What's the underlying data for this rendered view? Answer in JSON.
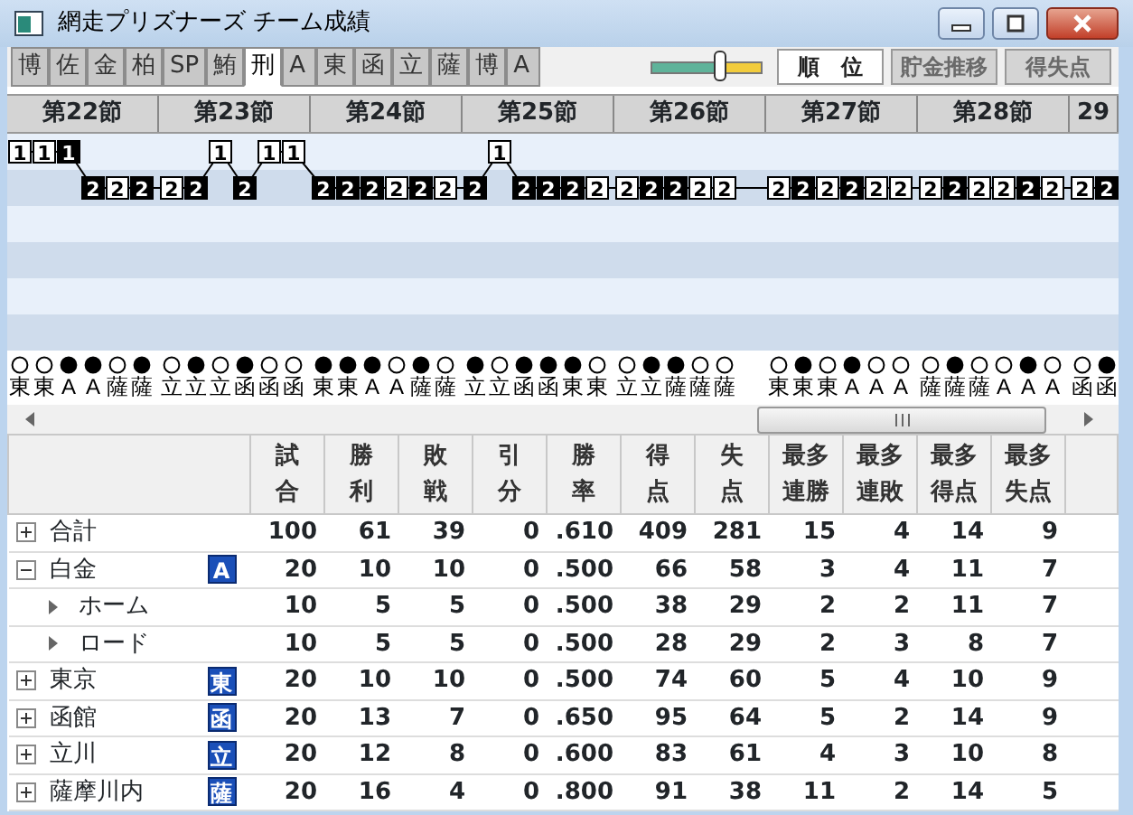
{
  "window": {
    "title": "網走プリズナーズ チーム成績"
  },
  "team_tabs": [
    {
      "label": "博",
      "selected": false
    },
    {
      "label": "佐",
      "selected": false
    },
    {
      "label": "金",
      "selected": false
    },
    {
      "label": "柏",
      "selected": false
    },
    {
      "label": "SP",
      "selected": false
    },
    {
      "label": "鮪",
      "selected": false
    },
    {
      "label": "刑",
      "selected": true
    },
    {
      "label": "A",
      "selected": false
    },
    {
      "label": "東",
      "selected": false
    },
    {
      "label": "函",
      "selected": false
    },
    {
      "label": "立",
      "selected": false
    },
    {
      "label": "薩",
      "selected": false
    },
    {
      "label": "博",
      "selected": false
    },
    {
      "label": "A",
      "selected": false
    }
  ],
  "zoom_slider": {
    "level": 0.62
  },
  "view_buttons": [
    {
      "label": "順　位",
      "selected": true,
      "disabled": false
    },
    {
      "label": "貯金推移",
      "selected": false,
      "disabled": true
    },
    {
      "label": "得失点",
      "selected": false,
      "disabled": true
    }
  ],
  "sections": [
    {
      "label": "第22節",
      "games": [
        {
          "rank": "1",
          "win": false,
          "opponent": "東"
        },
        {
          "rank": "1",
          "win": false,
          "opponent": "東"
        },
        {
          "rank": "1",
          "win": true,
          "opponent": "A"
        },
        {
          "rank": "2",
          "win": true,
          "opponent": "A"
        },
        {
          "rank": "2",
          "win": false,
          "opponent": "薩"
        },
        {
          "rank": "2",
          "win": true,
          "opponent": "薩"
        }
      ]
    },
    {
      "label": "第23節",
      "games": [
        {
          "rank": "2",
          "win": false,
          "opponent": "立"
        },
        {
          "rank": "2",
          "win": true,
          "opponent": "立"
        },
        {
          "rank": "1",
          "win": false,
          "opponent": "立"
        },
        {
          "rank": "2",
          "win": true,
          "opponent": "函"
        },
        {
          "rank": "1",
          "win": false,
          "opponent": "函"
        },
        {
          "rank": "1",
          "win": false,
          "opponent": "函"
        }
      ]
    },
    {
      "label": "第24節",
      "games": [
        {
          "rank": "2",
          "win": true,
          "opponent": "東"
        },
        {
          "rank": "2",
          "win": true,
          "opponent": "東"
        },
        {
          "rank": "2",
          "win": true,
          "opponent": "A"
        },
        {
          "rank": "2",
          "win": false,
          "opponent": "A"
        },
        {
          "rank": "2",
          "win": true,
          "opponent": "薩"
        },
        {
          "rank": "2",
          "win": false,
          "opponent": "薩"
        }
      ]
    },
    {
      "label": "第25節",
      "games": [
        {
          "rank": "2",
          "win": true,
          "opponent": "立"
        },
        {
          "rank": "1",
          "win": false,
          "opponent": "立"
        },
        {
          "rank": "2",
          "win": true,
          "opponent": "函"
        },
        {
          "rank": "2",
          "win": true,
          "opponent": "函"
        },
        {
          "rank": "2",
          "win": true,
          "opponent": "東"
        },
        {
          "rank": "2",
          "win": false,
          "opponent": "東"
        }
      ]
    },
    {
      "label": "第26節",
      "games": [
        {
          "rank": "2",
          "win": false,
          "opponent": "立"
        },
        {
          "rank": "2",
          "win": true,
          "opponent": "立"
        },
        {
          "rank": "2",
          "win": true,
          "opponent": "薩"
        },
        {
          "rank": "2",
          "win": false,
          "opponent": "薩"
        },
        {
          "rank": "2",
          "win": false,
          "opponent": "薩"
        }
      ]
    },
    {
      "label": "第27節",
      "games": [
        {
          "rank": "2",
          "win": false,
          "opponent": "東"
        },
        {
          "rank": "2",
          "win": true,
          "opponent": "東"
        },
        {
          "rank": "2",
          "win": false,
          "opponent": "東"
        },
        {
          "rank": "2",
          "win": true,
          "opponent": "A"
        },
        {
          "rank": "2",
          "win": false,
          "opponent": "A"
        },
        {
          "rank": "2",
          "win": false,
          "opponent": "A"
        }
      ]
    },
    {
      "label": "第28節",
      "games": [
        {
          "rank": "2",
          "win": false,
          "opponent": "薩"
        },
        {
          "rank": "2",
          "win": true,
          "opponent": "薩"
        },
        {
          "rank": "2",
          "win": false,
          "opponent": "薩"
        },
        {
          "rank": "2",
          "win": false,
          "opponent": "A"
        },
        {
          "rank": "2",
          "win": true,
          "opponent": "A"
        },
        {
          "rank": "2",
          "win": false,
          "opponent": "A"
        }
      ]
    },
    {
      "label": "29",
      "games": [
        {
          "rank": "2",
          "win": false,
          "opponent": "函"
        },
        {
          "rank": "2",
          "win": true,
          "opponent": "函"
        }
      ]
    }
  ],
  "table": {
    "columns": [
      "試合",
      "勝利",
      "敗戦",
      "引分",
      "勝率",
      "得点",
      "失点",
      "最多連勝",
      "最多連敗",
      "最多得点",
      "最多失点"
    ],
    "rows": [
      {
        "name": "合計",
        "expanded": false,
        "values": [
          "100",
          "61",
          "39",
          "0",
          ".610",
          "409",
          "281",
          "15",
          "4",
          "14",
          "9"
        ]
      },
      {
        "name": "白金",
        "expanded": true,
        "badge": "A",
        "values": [
          "20",
          "10",
          "10",
          "0",
          ".500",
          "66",
          "58",
          "3",
          "4",
          "11",
          "7"
        ],
        "children": [
          {
            "name": "ホーム",
            "values": [
              "10",
              "5",
              "5",
              "0",
              ".500",
              "38",
              "29",
              "2",
              "2",
              "11",
              "7"
            ]
          },
          {
            "name": "ロード",
            "values": [
              "10",
              "5",
              "5",
              "0",
              ".500",
              "28",
              "29",
              "2",
              "3",
              "8",
              "7"
            ]
          }
        ]
      },
      {
        "name": "東京",
        "expanded": false,
        "badge": "東",
        "values": [
          "20",
          "10",
          "10",
          "0",
          ".500",
          "74",
          "60",
          "5",
          "4",
          "10",
          "9"
        ]
      },
      {
        "name": "函館",
        "expanded": false,
        "badge": "函",
        "values": [
          "20",
          "13",
          "7",
          "0",
          ".650",
          "95",
          "64",
          "5",
          "2",
          "14",
          "9"
        ]
      },
      {
        "name": "立川",
        "expanded": false,
        "badge": "立",
        "values": [
          "20",
          "12",
          "8",
          "0",
          ".600",
          "83",
          "61",
          "4",
          "3",
          "10",
          "8"
        ]
      },
      {
        "name": "薩摩川内",
        "expanded": false,
        "badge": "薩",
        "values": [
          "20",
          "16",
          "4",
          "0",
          ".800",
          "91",
          "38",
          "11",
          "2",
          "14",
          "5"
        ]
      }
    ]
  }
}
